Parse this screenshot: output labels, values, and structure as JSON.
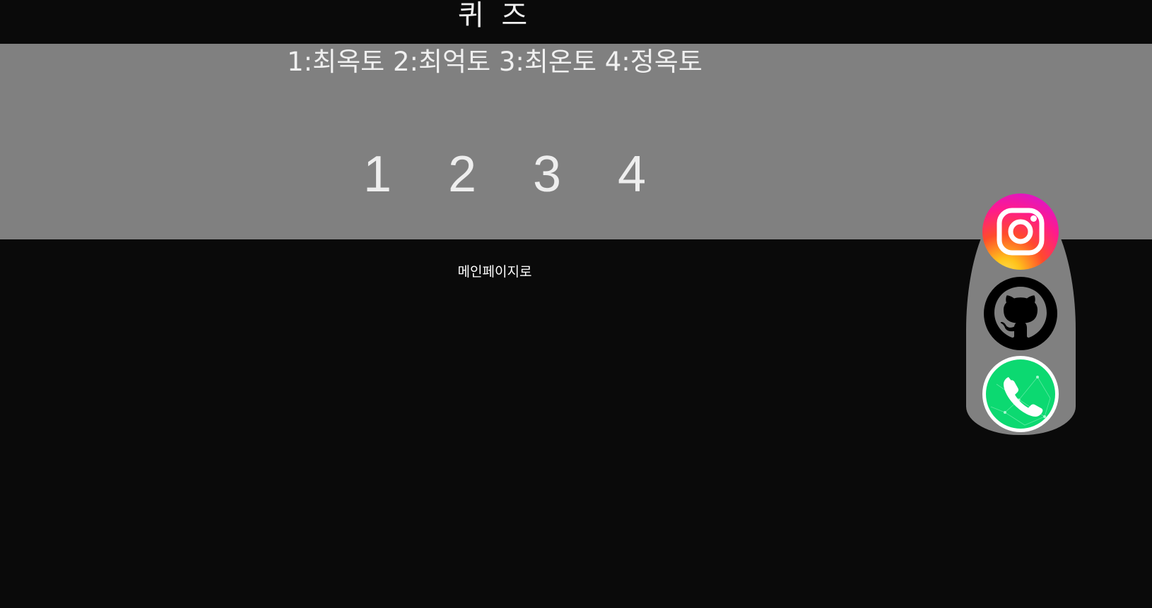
{
  "header": {
    "title": "퀴 즈"
  },
  "quiz": {
    "question": "1:최옥토 2:최억토 3:최온토 4:정옥토",
    "answers": [
      "1",
      "2",
      "3",
      "4"
    ]
  },
  "nav": {
    "main_link": "메인페이지로"
  },
  "social": {
    "items": [
      {
        "icon": "instagram-icon"
      },
      {
        "icon": "github-icon"
      },
      {
        "icon": "phone-icon"
      }
    ]
  },
  "colors": {
    "background": "#0a0a0a",
    "panel": "#808080",
    "text": "#f0f0f0",
    "phone_green": "#0cd971"
  }
}
